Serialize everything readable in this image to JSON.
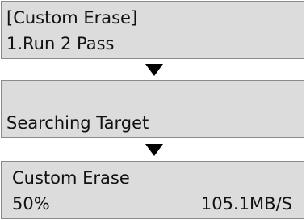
{
  "screens": [
    {
      "line1": "[Custom Erase]",
      "line2": "1.Run 2 Pass"
    },
    {
      "line1": "",
      "line2": "Searching Target"
    },
    {
      "line1": "Custom Erase",
      "progress": "50%",
      "speed": "105.1MB/S"
    }
  ],
  "arrows": [
    {
      "icon": "down-triangle-icon"
    },
    {
      "icon": "down-triangle-icon"
    }
  ],
  "colors": {
    "lcd_background": "#dcdcdc",
    "lcd_border": "#8a8a8a",
    "text": "#111111",
    "arrow": "#000000"
  }
}
